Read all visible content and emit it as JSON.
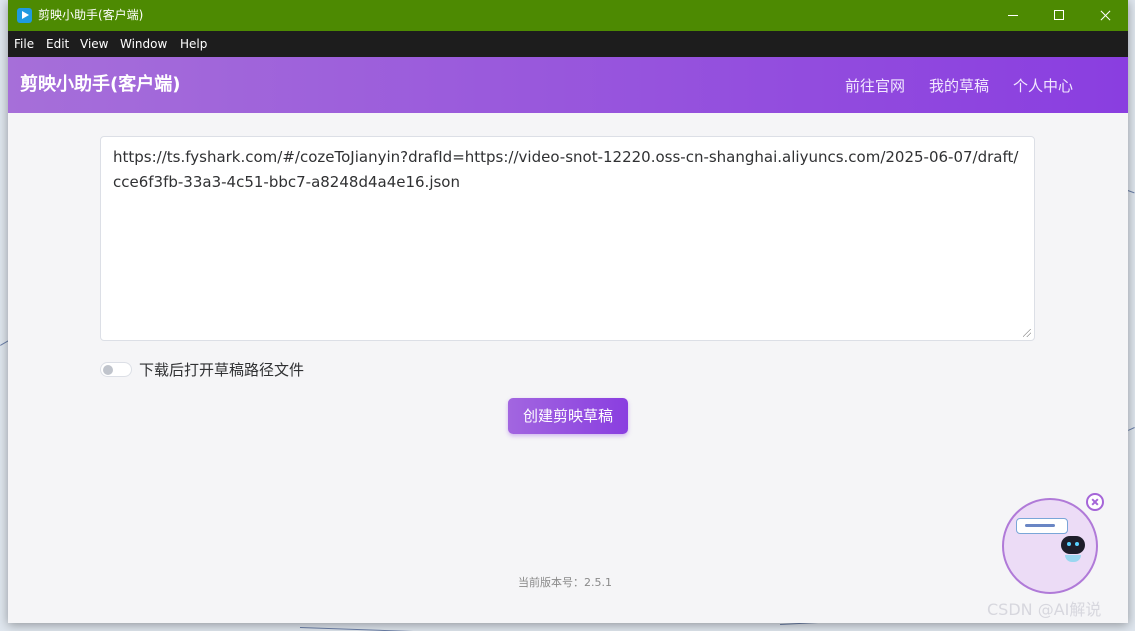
{
  "window": {
    "title": "剪映小助手(客户端)",
    "title_bar_color": "#4d8a02"
  },
  "menubar": {
    "items": [
      "File",
      "Edit",
      "View",
      "Window",
      "Help"
    ]
  },
  "header": {
    "brand": "剪映小助手(客户端)",
    "nav": [
      "前往官网",
      "我的草稿",
      "个人中心"
    ],
    "gradient_start": "#a66fd9",
    "gradient_end": "#8a3ee0"
  },
  "main": {
    "url_value": "https://ts.fyshark.com/#/cozeToJianyin?drafId=https://video-snot-12220.oss-cn-shanghai.aliyuncs.com/2025-06-07/draft/cce6f3fb-33a3-4c51-bbc7-a8248d4a4e16.json",
    "open_after_download_label": "下载后打开草稿路径文件",
    "open_after_download_on": false,
    "create_button": "创建剪映草稿",
    "version_text": "当前版本号：2.5.1"
  },
  "assistant": {
    "icon": "robot-assistant-icon",
    "close_icon": "close-circle-icon"
  },
  "watermark": "CSDN @AI解说"
}
